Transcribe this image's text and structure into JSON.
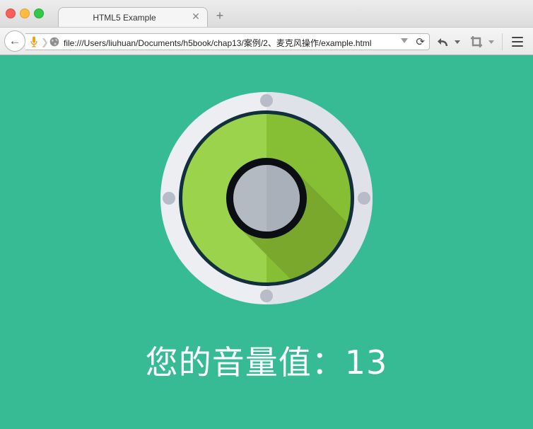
{
  "window": {
    "tab_title": "HTML5 Example"
  },
  "navbar": {
    "url": "file:///Users/liuhuan/Documents/h5book/chap13/案例/2、麦克风操作/example.html"
  },
  "icons": {
    "back": "back-arrow-icon",
    "microphone": "microphone-icon",
    "globe": "globe-icon",
    "reload": "reload-icon",
    "undo": "undo-icon",
    "crop": "crop-icon",
    "menu": "hamburger-menu-icon"
  },
  "page": {
    "volume_label": "您的音量值：",
    "volume_value": "13"
  },
  "colors": {
    "background": "#36bb95",
    "dial_rim": "#eceef2",
    "dial_ring": "#122f3e",
    "dial_green_light": "#9bd44c",
    "dial_green_dark": "#86be34",
    "dial_center": "#b4bac2"
  }
}
